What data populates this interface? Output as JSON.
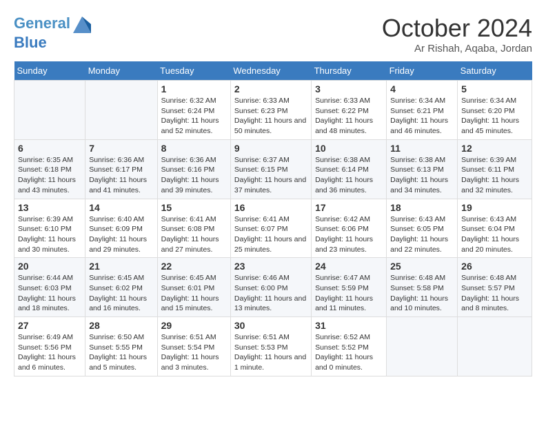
{
  "header": {
    "logo_line1": "General",
    "logo_line2": "Blue",
    "month": "October 2024",
    "location": "Ar Rishah, Aqaba, Jordan"
  },
  "weekdays": [
    "Sunday",
    "Monday",
    "Tuesday",
    "Wednesday",
    "Thursday",
    "Friday",
    "Saturday"
  ],
  "weeks": [
    [
      {
        "day": "",
        "text": ""
      },
      {
        "day": "",
        "text": ""
      },
      {
        "day": "1",
        "text": "Sunrise: 6:32 AM\nSunset: 6:24 PM\nDaylight: 11 hours and 52 minutes."
      },
      {
        "day": "2",
        "text": "Sunrise: 6:33 AM\nSunset: 6:23 PM\nDaylight: 11 hours and 50 minutes."
      },
      {
        "day": "3",
        "text": "Sunrise: 6:33 AM\nSunset: 6:22 PM\nDaylight: 11 hours and 48 minutes."
      },
      {
        "day": "4",
        "text": "Sunrise: 6:34 AM\nSunset: 6:21 PM\nDaylight: 11 hours and 46 minutes."
      },
      {
        "day": "5",
        "text": "Sunrise: 6:34 AM\nSunset: 6:20 PM\nDaylight: 11 hours and 45 minutes."
      }
    ],
    [
      {
        "day": "6",
        "text": "Sunrise: 6:35 AM\nSunset: 6:18 PM\nDaylight: 11 hours and 43 minutes."
      },
      {
        "day": "7",
        "text": "Sunrise: 6:36 AM\nSunset: 6:17 PM\nDaylight: 11 hours and 41 minutes."
      },
      {
        "day": "8",
        "text": "Sunrise: 6:36 AM\nSunset: 6:16 PM\nDaylight: 11 hours and 39 minutes."
      },
      {
        "day": "9",
        "text": "Sunrise: 6:37 AM\nSunset: 6:15 PM\nDaylight: 11 hours and 37 minutes."
      },
      {
        "day": "10",
        "text": "Sunrise: 6:38 AM\nSunset: 6:14 PM\nDaylight: 11 hours and 36 minutes."
      },
      {
        "day": "11",
        "text": "Sunrise: 6:38 AM\nSunset: 6:13 PM\nDaylight: 11 hours and 34 minutes."
      },
      {
        "day": "12",
        "text": "Sunrise: 6:39 AM\nSunset: 6:11 PM\nDaylight: 11 hours and 32 minutes."
      }
    ],
    [
      {
        "day": "13",
        "text": "Sunrise: 6:39 AM\nSunset: 6:10 PM\nDaylight: 11 hours and 30 minutes."
      },
      {
        "day": "14",
        "text": "Sunrise: 6:40 AM\nSunset: 6:09 PM\nDaylight: 11 hours and 29 minutes."
      },
      {
        "day": "15",
        "text": "Sunrise: 6:41 AM\nSunset: 6:08 PM\nDaylight: 11 hours and 27 minutes."
      },
      {
        "day": "16",
        "text": "Sunrise: 6:41 AM\nSunset: 6:07 PM\nDaylight: 11 hours and 25 minutes."
      },
      {
        "day": "17",
        "text": "Sunrise: 6:42 AM\nSunset: 6:06 PM\nDaylight: 11 hours and 23 minutes."
      },
      {
        "day": "18",
        "text": "Sunrise: 6:43 AM\nSunset: 6:05 PM\nDaylight: 11 hours and 22 minutes."
      },
      {
        "day": "19",
        "text": "Sunrise: 6:43 AM\nSunset: 6:04 PM\nDaylight: 11 hours and 20 minutes."
      }
    ],
    [
      {
        "day": "20",
        "text": "Sunrise: 6:44 AM\nSunset: 6:03 PM\nDaylight: 11 hours and 18 minutes."
      },
      {
        "day": "21",
        "text": "Sunrise: 6:45 AM\nSunset: 6:02 PM\nDaylight: 11 hours and 16 minutes."
      },
      {
        "day": "22",
        "text": "Sunrise: 6:45 AM\nSunset: 6:01 PM\nDaylight: 11 hours and 15 minutes."
      },
      {
        "day": "23",
        "text": "Sunrise: 6:46 AM\nSunset: 6:00 PM\nDaylight: 11 hours and 13 minutes."
      },
      {
        "day": "24",
        "text": "Sunrise: 6:47 AM\nSunset: 5:59 PM\nDaylight: 11 hours and 11 minutes."
      },
      {
        "day": "25",
        "text": "Sunrise: 6:48 AM\nSunset: 5:58 PM\nDaylight: 11 hours and 10 minutes."
      },
      {
        "day": "26",
        "text": "Sunrise: 6:48 AM\nSunset: 5:57 PM\nDaylight: 11 hours and 8 minutes."
      }
    ],
    [
      {
        "day": "27",
        "text": "Sunrise: 6:49 AM\nSunset: 5:56 PM\nDaylight: 11 hours and 6 minutes."
      },
      {
        "day": "28",
        "text": "Sunrise: 6:50 AM\nSunset: 5:55 PM\nDaylight: 11 hours and 5 minutes."
      },
      {
        "day": "29",
        "text": "Sunrise: 6:51 AM\nSunset: 5:54 PM\nDaylight: 11 hours and 3 minutes."
      },
      {
        "day": "30",
        "text": "Sunrise: 6:51 AM\nSunset: 5:53 PM\nDaylight: 11 hours and 1 minute."
      },
      {
        "day": "31",
        "text": "Sunrise: 6:52 AM\nSunset: 5:52 PM\nDaylight: 11 hours and 0 minutes."
      },
      {
        "day": "",
        "text": ""
      },
      {
        "day": "",
        "text": ""
      }
    ]
  ]
}
